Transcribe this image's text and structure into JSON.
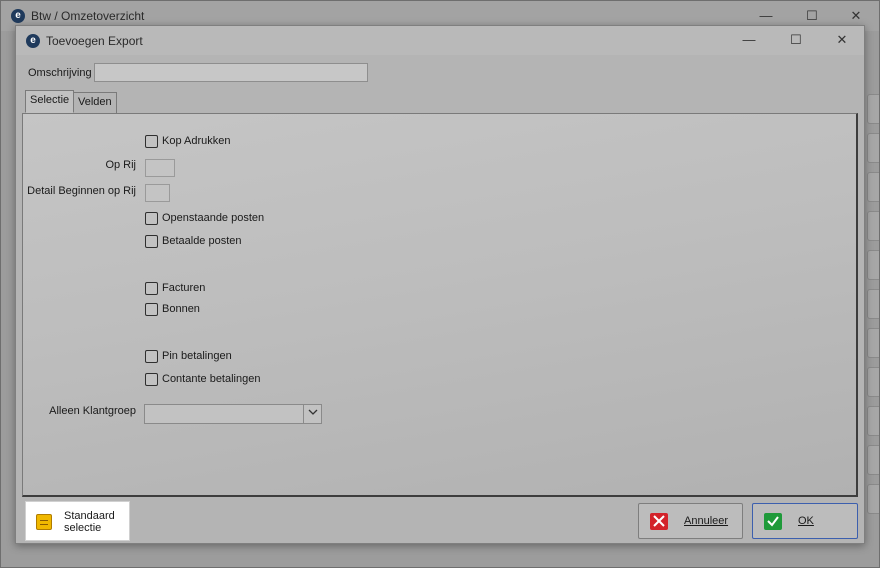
{
  "parent_window": {
    "title": "Btw / Omzetoverzicht",
    "minimize": "—",
    "maximize": "☐",
    "close": "✕"
  },
  "dialog": {
    "title": "Toevoegen Export",
    "minimize": "—",
    "maximize": "☐",
    "close": "✕"
  },
  "omschrijving": {
    "label": "Omschrijving",
    "value": ""
  },
  "tabs": [
    {
      "label": "Selectie",
      "active": true
    },
    {
      "label": "Velden",
      "active": false
    }
  ],
  "selectie": {
    "kop_adrukken": {
      "label": "Kop Adrukken",
      "checked": false
    },
    "op_rij": {
      "label": "Op Rij",
      "value": ""
    },
    "detail_beginnen": {
      "label": "Detail Beginnen op Rij",
      "value": ""
    },
    "openstaande_posten": {
      "label": "Openstaande posten",
      "checked": false
    },
    "betaalde_posten": {
      "label": "Betaalde posten",
      "checked": false
    },
    "facturen": {
      "label": "Facturen",
      "checked": false
    },
    "bonnen": {
      "label": "Bonnen",
      "checked": false
    },
    "pin_betalingen": {
      "label": "Pin betalingen",
      "checked": false
    },
    "contante_betalingen": {
      "label": "Contante betalingen",
      "checked": false
    },
    "alleen_klantgroep": {
      "label": "Alleen Klantgroep",
      "value": ""
    }
  },
  "buttons": {
    "standaard_selectie": "Standaard selectie",
    "annuleer": "Annuleer",
    "ok": "OK"
  },
  "icons": {
    "app": "app-logo-icon",
    "std": "notepad-icon",
    "cancel": "red-x-icon",
    "ok": "green-check-icon"
  },
  "colors": {
    "cancel_icon": "#d3232a",
    "ok_icon": "#1f9a3a",
    "ok_border": "#3c5fae"
  }
}
